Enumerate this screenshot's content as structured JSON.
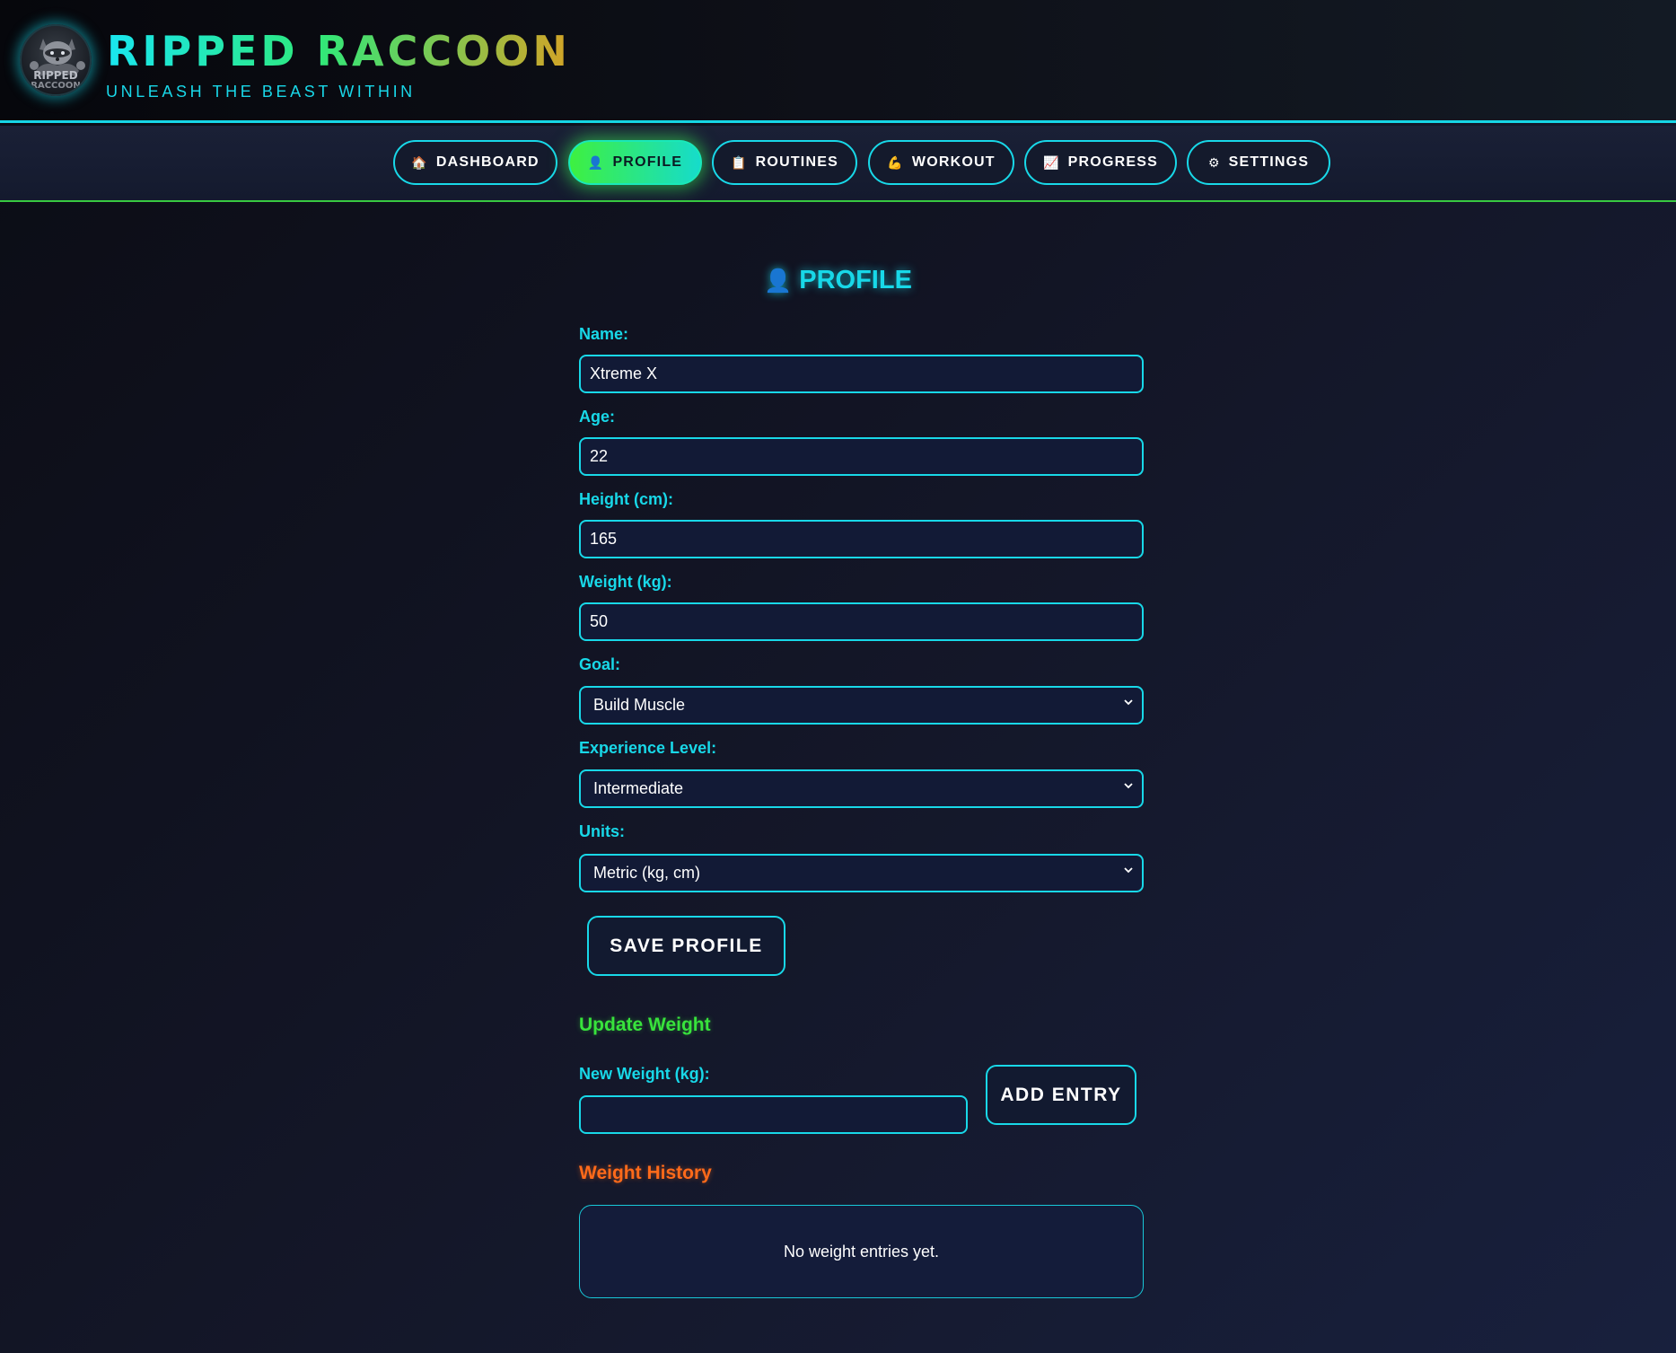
{
  "app": {
    "title": "RIPPED RACCOON",
    "subtitle": "UNLEASH THE BEAST WITHIN",
    "logo_text": [
      "RIPPED",
      "RACCOON"
    ]
  },
  "nav": {
    "items": [
      {
        "label": "DASHBOARD",
        "icon": "house-icon",
        "glyph": "🏠",
        "active": false
      },
      {
        "label": "PROFILE",
        "icon": "user-icon",
        "glyph": "👤",
        "active": true
      },
      {
        "label": "ROUTINES",
        "icon": "clipboard-icon",
        "glyph": "📋",
        "active": false
      },
      {
        "label": "WORKOUT",
        "icon": "flexed-bicep-icon",
        "glyph": "💪",
        "active": false
      },
      {
        "label": "PROGRESS",
        "icon": "chart-icon",
        "glyph": "📈",
        "active": false
      },
      {
        "label": "SETTINGS",
        "icon": "gear-icon",
        "glyph": "⚙",
        "active": false
      }
    ]
  },
  "profile": {
    "title": "PROFILE",
    "title_icon": "user-icon",
    "name": {
      "label": "Name:",
      "value": "Xtreme X"
    },
    "age": {
      "label": "Age:",
      "value": "22"
    },
    "height": {
      "label": "Height (cm):",
      "value": "165"
    },
    "weight": {
      "label": "Weight (kg):",
      "value": "50"
    },
    "goal": {
      "label": "Goal:",
      "selected": "Build Muscle"
    },
    "experience": {
      "label": "Experience Level:",
      "selected": "Intermediate"
    },
    "units": {
      "label": "Units:",
      "selected": "Metric (kg, cm)"
    },
    "save_label": "SAVE PROFILE"
  },
  "update_weight": {
    "title": "Update Weight",
    "label": "New Weight (kg):",
    "value": "",
    "button_label": "ADD ENTRY"
  },
  "weight_history": {
    "title": "Weight History",
    "empty_text": "No weight entries yet."
  },
  "colors": {
    "accent_cyan": "#18d8e8",
    "accent_green": "#38e33c",
    "accent_orange": "#ff6a1a",
    "background": "#141729"
  }
}
